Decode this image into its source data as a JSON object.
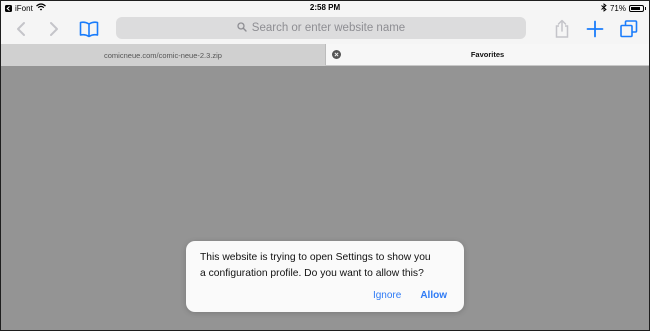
{
  "status_bar": {
    "carrier": "iFont",
    "time": "2:58 PM",
    "battery_percent": "71%",
    "battery_level": 0.71
  },
  "toolbar": {
    "address_placeholder": "Search or enter website name",
    "icons": [
      "back-icon",
      "forward-icon",
      "bookmarks-icon",
      "share-icon",
      "new-tab-icon",
      "tabs-icon"
    ]
  },
  "tabs": [
    {
      "label": "comicneue.com/comic-neue-2.3.zip",
      "active": false
    },
    {
      "label": "Favorites",
      "active": true
    }
  ],
  "dialog": {
    "message": "This website is trying to open Settings to show you\na configuration profile. Do you want to allow this?",
    "ignore_label": "Ignore",
    "allow_label": "Allow"
  },
  "colors": {
    "accent": "#2f7bf5",
    "content_background": "#949494",
    "bar_background": "#f5f5f5"
  }
}
